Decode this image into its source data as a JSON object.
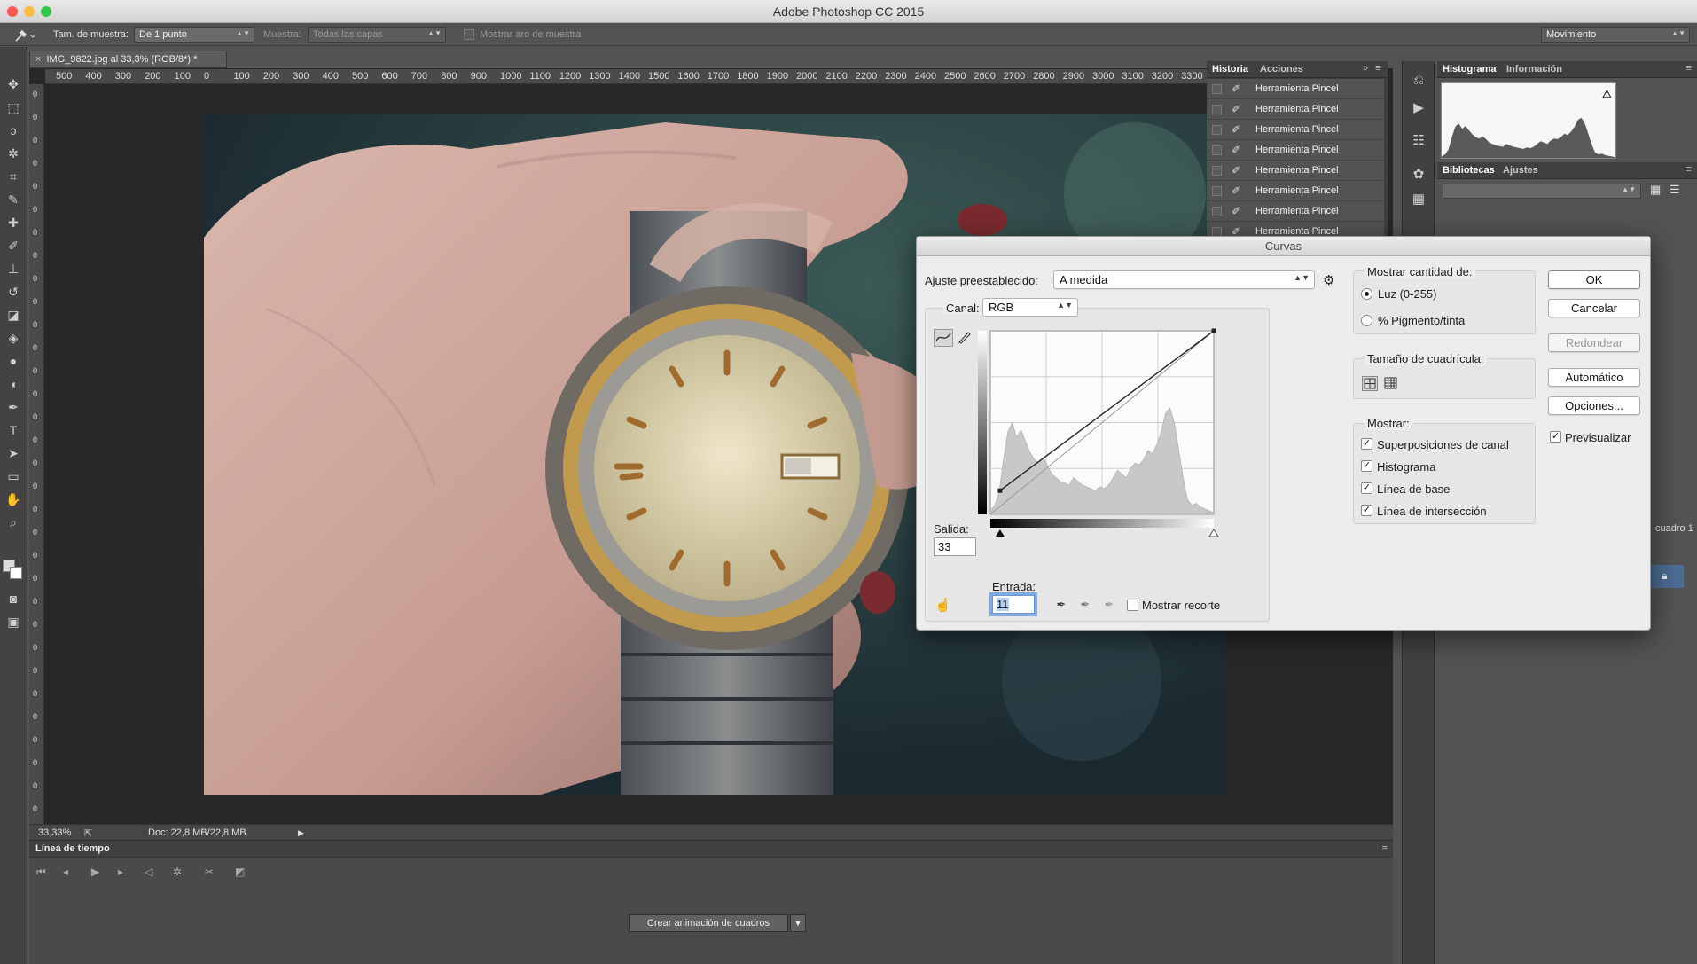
{
  "app": {
    "title": "Adobe Photoshop CC 2015",
    "traffic_lights": [
      "#fc5753",
      "#fdbc40",
      "#33c748"
    ]
  },
  "options_bar": {
    "sample_size_label": "Tam. de muestra:",
    "sample_size_value": "De 1 punto",
    "sample_label": "Muestra:",
    "sample_value": "Todas las capas",
    "show_ring_label": "Mostrar aro de muestra",
    "workspace_value": "Movimiento"
  },
  "document": {
    "tab_title": "IMG_9822.jpg al 33,3% (RGB/8*) *",
    "ruler_ticks": [
      "500",
      "400",
      "300",
      "200",
      "100",
      "0",
      "100",
      "200",
      "300",
      "400",
      "500",
      "600",
      "700",
      "800",
      "900",
      "1000",
      "1100",
      "1200",
      "1300",
      "1400",
      "1500",
      "1600",
      "1700",
      "1800",
      "1900",
      "2000",
      "2100",
      "2200",
      "2300",
      "2400",
      "2500",
      "2600",
      "2700",
      "2800",
      "2900",
      "3000",
      "3100",
      "3200",
      "3300"
    ],
    "zoom": "33,33%",
    "doc_info": "Doc: 22,8 MB/22,8 MB"
  },
  "timeline": {
    "title": "Línea de tiempo",
    "create_button": "Crear animación de cuadros",
    "dropdown_icon": "chevron-down-icon"
  },
  "history_panel": {
    "tabs": [
      "Historia",
      "Acciones"
    ],
    "items": [
      "Herramienta Pincel",
      "Herramienta Pincel",
      "Herramienta Pincel",
      "Herramienta Pincel",
      "Herramienta Pincel",
      "Herramienta Pincel",
      "Herramienta Pincel",
      "Herramienta Pincel"
    ]
  },
  "right_panels": {
    "top_tabs": [
      "Histograma",
      "Información"
    ],
    "mid_tabs": [
      "Bibliotecas",
      "Ajustes"
    ],
    "layers_partial": "cuadro 1"
  },
  "curves_dialog": {
    "title": "Curvas",
    "preset_label": "Ajuste preestablecido:",
    "preset_value": "A medida",
    "channel_label": "Canal:",
    "channel_value": "RGB",
    "output_label": "Salida:",
    "output_value": "33",
    "input_label": "Entrada:",
    "input_value": "11",
    "show_clipping_label": "Mostrar recorte",
    "show_amount_title": "Mostrar cantidad de:",
    "amount_options": [
      "Luz (0-255)",
      "% Pigmento/tinta"
    ],
    "amount_selected": 0,
    "grid_size_title": "Tamaño de cuadrícula:",
    "show_title": "Mostrar:",
    "show_options": [
      {
        "label": "Superposiciones de canal",
        "checked": true
      },
      {
        "label": "Histograma",
        "checked": true
      },
      {
        "label": "Línea de base",
        "checked": true
      },
      {
        "label": "Línea de intersección",
        "checked": true
      }
    ],
    "buttons": {
      "ok": "OK",
      "cancel": "Cancelar",
      "smooth": "Redondear",
      "auto": "Automático",
      "options": "Opciones..."
    },
    "preview_label": "Previsualizar",
    "preview_checked": true,
    "curve_points": [
      [
        11,
        33
      ],
      [
        255,
        255
      ]
    ],
    "histogram_profile": [
      0.02,
      0.05,
      0.12,
      0.3,
      0.45,
      0.5,
      0.42,
      0.46,
      0.4,
      0.34,
      0.3,
      0.28,
      0.31,
      0.27,
      0.22,
      0.2,
      0.18,
      0.17,
      0.16,
      0.2,
      0.18,
      0.16,
      0.15,
      0.14,
      0.13,
      0.15,
      0.14,
      0.16,
      0.2,
      0.24,
      0.22,
      0.2,
      0.25,
      0.28,
      0.27,
      0.3,
      0.35,
      0.33,
      0.38,
      0.45,
      0.55,
      0.58,
      0.5,
      0.35,
      0.2,
      0.08,
      0.05,
      0.06,
      0.04,
      0.03,
      0.02,
      0.01
    ]
  }
}
